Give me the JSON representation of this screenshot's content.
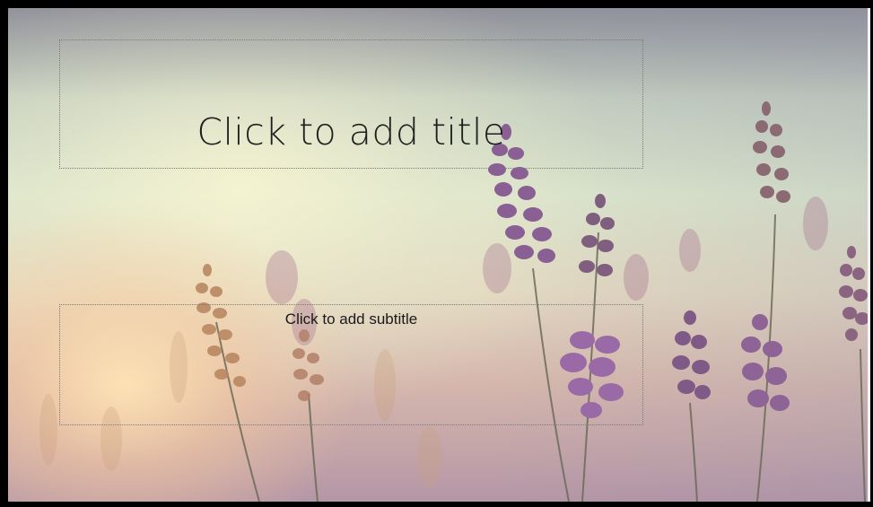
{
  "slide": {
    "title_placeholder": "Click to add title",
    "subtitle_placeholder": "Click to add subtitle",
    "background_image": "lavender-field-photo",
    "colors": {
      "frame": "#000000",
      "text": "#1e1e1e",
      "lavender": "#8a5f93"
    }
  }
}
